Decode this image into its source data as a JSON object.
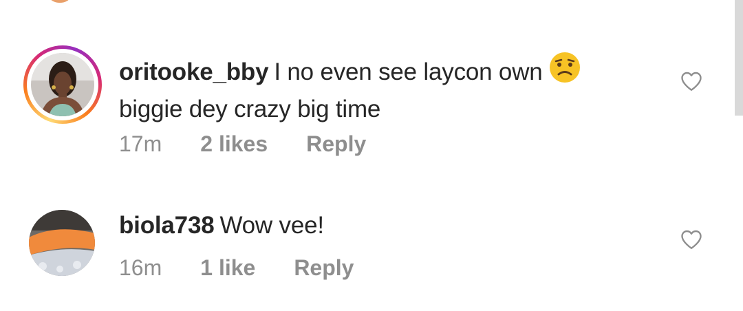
{
  "comments": [
    {
      "username": "oritooke_bby",
      "text_line1": "I no even see laycon own",
      "emoji": "worried-face-emoji",
      "text_line2": "biggie dey crazy big time",
      "time": "17m",
      "likes": "2 likes",
      "reply": "Reply",
      "has_story_ring": true
    },
    {
      "username": "biola738",
      "text_line1": "Wow vee!",
      "time": "16m",
      "likes": "1 like",
      "reply": "Reply",
      "has_story_ring": false
    }
  ],
  "icons": {
    "like": "heart-outline-icon"
  },
  "colors": {
    "text_primary": "#262626",
    "text_secondary": "#8e8e8e",
    "story_ring": [
      "#feda75",
      "#fa7e1e",
      "#d62976",
      "#962fbf"
    ],
    "emoji_face": "#f7c325"
  }
}
